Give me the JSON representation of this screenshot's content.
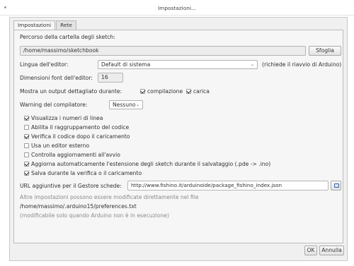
{
  "window": {
    "title": "Impostazioni..."
  },
  "tabs": [
    {
      "label": "Impostazioni",
      "active": true
    },
    {
      "label": "Rete",
      "active": false
    }
  ],
  "sketchbook": {
    "label": "Percorso della cartella degli sketch:",
    "value": "/home/massimo/sketchbook",
    "browse_label": "Sfoglia"
  },
  "language": {
    "label": "Lingua dell'editor:",
    "selected": "Default di sistema",
    "note": "(richiede il riavvio di Arduino)"
  },
  "font_size": {
    "label": "Dimensioni font dell'editor:",
    "value": "16"
  },
  "verbose": {
    "label": "Mostra un output dettagliato durante:",
    "options": [
      {
        "label": "compilazione",
        "checked": true
      },
      {
        "label": "carica",
        "checked": true
      }
    ]
  },
  "warnings": {
    "label": "Warning del compilatore:",
    "selected": "Nessuno"
  },
  "options": [
    {
      "label": "Visualizza i numeri di linea",
      "checked": true
    },
    {
      "label": "Abilita il raggruppamento del codice",
      "checked": false
    },
    {
      "label": "Verifica il codice dopo il caricamento",
      "checked": true
    },
    {
      "label": "Usa un editor esterno",
      "checked": false
    },
    {
      "label": "Controlla aggiornamenti all'avvio",
      "checked": false
    },
    {
      "label": "Aggiorna automaticamente l'estensione degli sketch durante il salvataggio (.pde -> .ino)",
      "checked": true
    },
    {
      "label": "Salva durante la verifica o il caricamento",
      "checked": true
    }
  ],
  "board_urls": {
    "label": "URL aggiuntive per il Gestore schede:",
    "value": "http://www.fishino.it/arduinoide/package_fishino_index.json"
  },
  "more": {
    "line1": "Altre impostazioni possono essere modificate direttamente nel file",
    "path": "/home/massimo/.arduino15/preferences.txt",
    "note": "(modificabile solo quando Arduino non è in esecuzione)"
  },
  "buttons": {
    "ok": "OK",
    "cancel": "Annulla"
  },
  "colors": {
    "panel": "#f6f6f6",
    "accent": "#2a5fb0"
  }
}
